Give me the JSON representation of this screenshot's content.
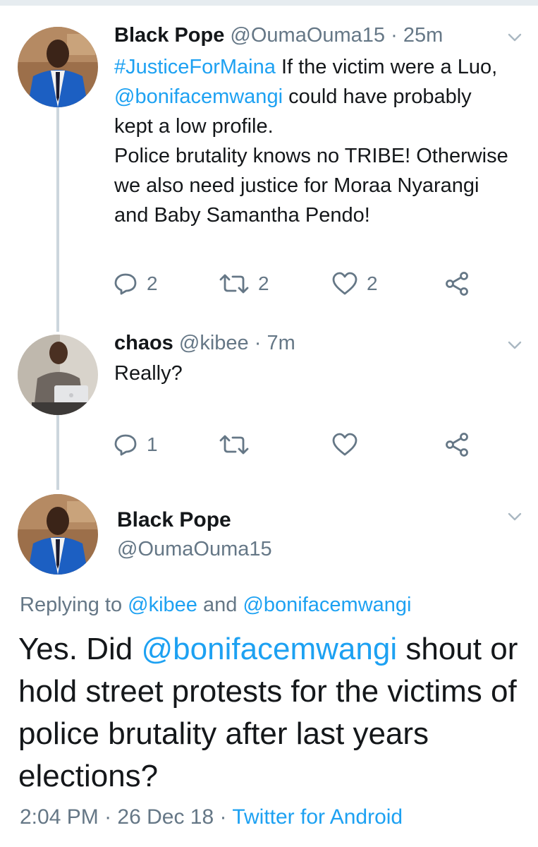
{
  "thread": [
    {
      "name": "Black Pope",
      "handle": "@OumaOuma15",
      "separator": "·",
      "time": "25m",
      "text_parts": [
        {
          "hashtag": "#JusticeForMaina"
        },
        {
          "plain": " If the victim were a Luo, "
        },
        {
          "mention": "@bonifacemwangi"
        },
        {
          "plain": " could have probably kept a low profile."
        },
        {
          "line2": "Police brutality knows no TRIBE! Otherwise we also need justice for Moraa Nyarangi and Baby Samantha Pendo!"
        }
      ],
      "hashtag": "#JusticeForMaina",
      "text_a": "If the victim were a Luo,",
      "mention": "@bonifacemwangi",
      "text_b": "could have probably kept a low profile.",
      "text_c": "Police brutality knows no TRIBE! Otherwise we also need justice for Moraa Nyarangi and Baby Samantha Pendo!",
      "actions": {
        "reply_count": "2",
        "retweet_count": "2",
        "like_count": "2"
      },
      "avatar": "man-in-blue-suit"
    },
    {
      "name": "chaos",
      "handle": "@kibee",
      "separator": "·",
      "time": "7m",
      "text": "Really?",
      "actions": {
        "reply_count": "1",
        "retweet_count": "",
        "like_count": ""
      },
      "avatar": "man-with-laptop"
    }
  ],
  "focused": {
    "name": "Black Pope",
    "handle": "@OumaOuma15",
    "reply_prefix": "Replying to",
    "reply_user1": "@kibee",
    "reply_and": "and",
    "reply_user2": "@bonifacemwangi",
    "text_a": "Yes. Did",
    "mention": "@bonifacemwangi",
    "text_b": "shout or hold street protests for the victims of police brutality after last years elections?",
    "time": "2:04 PM",
    "sep1": "·",
    "date": "26 Dec 18",
    "sep2": "·",
    "client": "Twitter for Android"
  },
  "icons": [
    "chevron-down-icon",
    "reply-icon",
    "retweet-icon",
    "like-icon",
    "share-icon"
  ],
  "colors": {
    "link": "#1da1f2",
    "secondary": "#657786",
    "thread_line": "#ccd6dd"
  }
}
